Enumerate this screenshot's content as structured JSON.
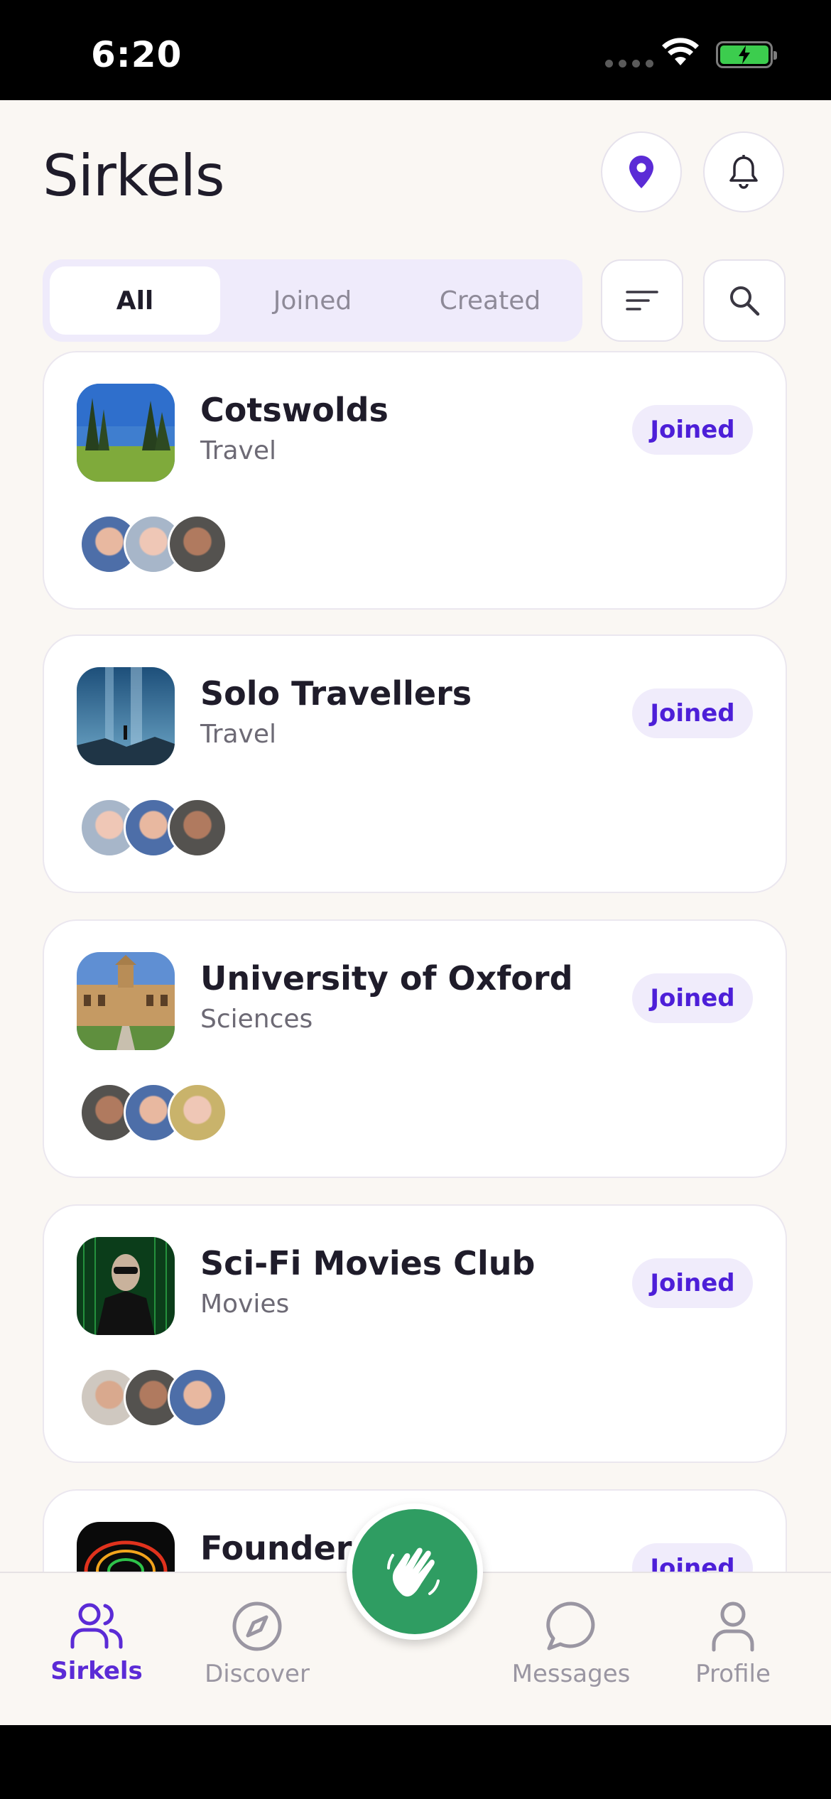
{
  "status_bar": {
    "time": "6:20"
  },
  "header": {
    "title": "Sirkels"
  },
  "filters": {
    "tabs": [
      {
        "label": "All",
        "active": true
      },
      {
        "label": "Joined",
        "active": false
      },
      {
        "label": "Created",
        "active": false
      }
    ]
  },
  "colors": {
    "accent": "#5b2bd6",
    "badge_text": "#4d1fd8",
    "fab": "#2f9d62",
    "background": "#faf7f3"
  },
  "groups": [
    {
      "name": "Cotswolds",
      "category": "Travel",
      "status": "Joined"
    },
    {
      "name": "Solo Travellers",
      "category": "Travel",
      "status": "Joined"
    },
    {
      "name": "University of Oxford",
      "category": "Sciences",
      "status": "Joined"
    },
    {
      "name": "Sci-Fi Movies Club",
      "category": "Movies",
      "status": "Joined"
    },
    {
      "name": "Founders",
      "category": "",
      "status": "Joined"
    }
  ],
  "bottom_nav": {
    "items": [
      {
        "label": "Sirkels",
        "icon": "people-icon"
      },
      {
        "label": "Discover",
        "icon": "compass-icon"
      },
      {
        "label": "Messages",
        "icon": "chat-bubble-icon"
      },
      {
        "label": "Profile",
        "icon": "person-icon"
      }
    ],
    "fab_icon": "wave-hand-icon"
  }
}
